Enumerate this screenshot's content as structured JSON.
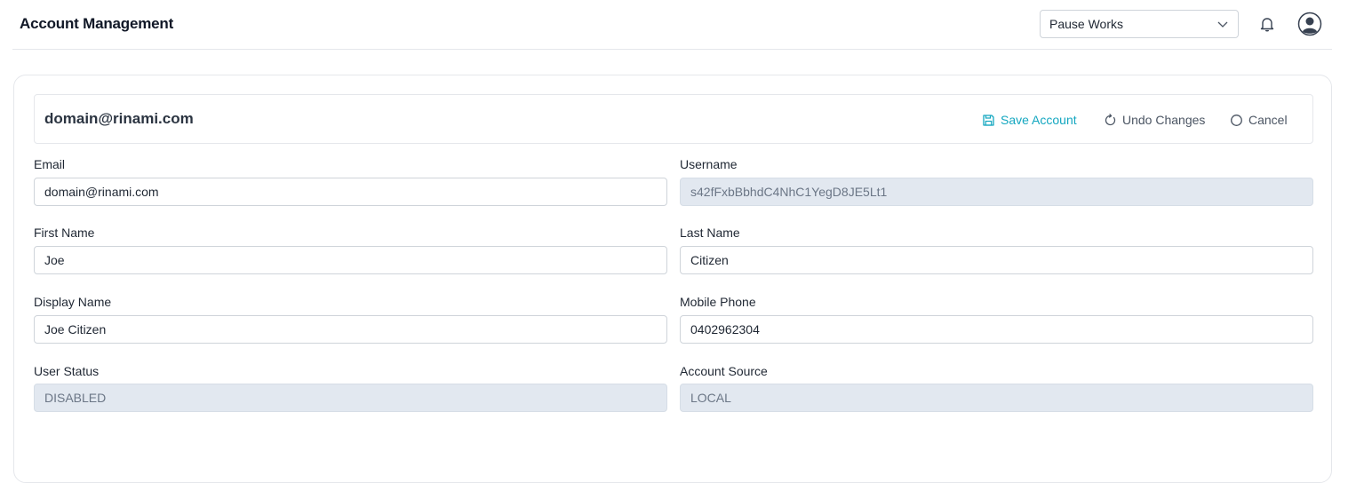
{
  "header": {
    "title": "Account Management",
    "org_selector": {
      "value": "Pause Works"
    },
    "icons": {
      "notifications": "bell-icon",
      "profile": "user-circle-icon",
      "dropdown": "chevron-down-icon"
    }
  },
  "account": {
    "title": "domain@rinami.com",
    "actions": {
      "save": "Save Account",
      "undo": "Undo Changes",
      "cancel": "Cancel"
    },
    "action_icons": {
      "save": "floppy-disk-icon",
      "undo": "refresh-icon",
      "cancel": "circle-icon"
    },
    "accent_color": "#14a7c0",
    "fields": {
      "email": {
        "label": "Email",
        "value": "domain@rinami.com"
      },
      "username": {
        "label": "Username",
        "value": "s42fFxbBbhdC4NhC1YegD8JE5Lt1",
        "readonly": true
      },
      "first_name": {
        "label": "First Name",
        "value": "Joe"
      },
      "last_name": {
        "label": "Last Name",
        "value": "Citizen"
      },
      "display_name": {
        "label": "Display Name",
        "value": "Joe Citizen"
      },
      "mobile_phone": {
        "label": "Mobile Phone",
        "value": "0402962304"
      },
      "user_status": {
        "label": "User Status",
        "value": "DISABLED",
        "readonly": true
      },
      "account_source": {
        "label": "Account Source",
        "value": "LOCAL",
        "readonly": true
      }
    }
  }
}
